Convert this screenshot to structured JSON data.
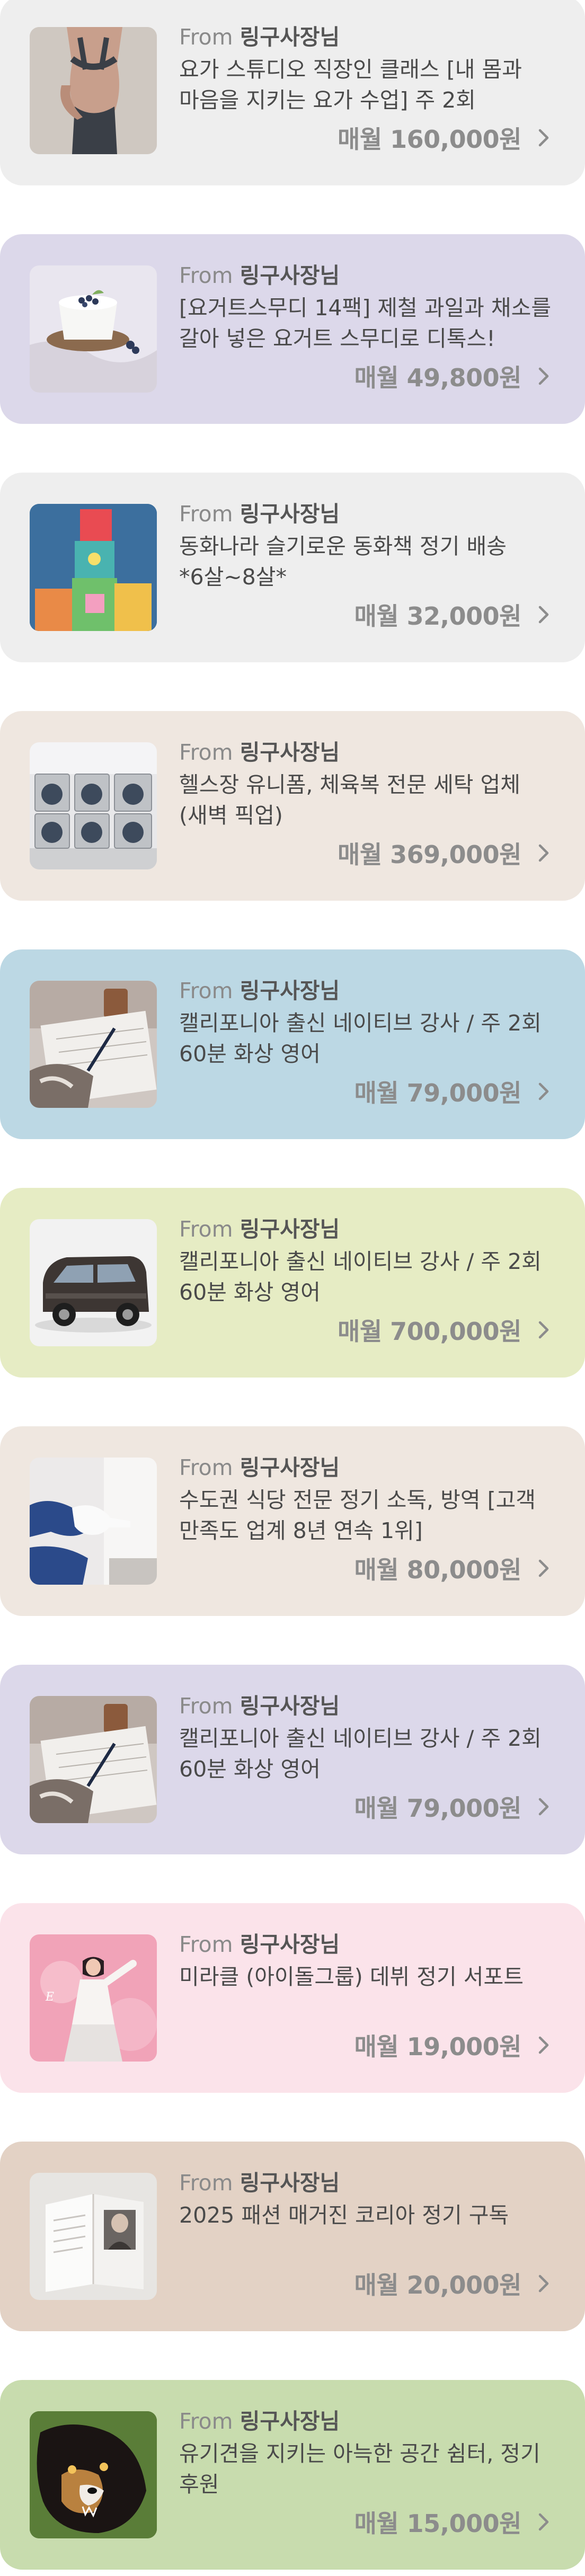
{
  "subscriptions": [
    {
      "from_label": "From",
      "sender": "링구사장님",
      "title": "요가 스튜디오 직장인 클래스 [내 몸과 마음을 지키는 요가 수업] 주 2회",
      "price": "매월 160,000원",
      "bg": "#eeeeee",
      "thumb": "yoga"
    },
    {
      "from_label": "From",
      "sender": "링구사장님",
      "title": "[요거트스무디 14팩] 제철 과일과 채소를 갈아 넣은 요거트 스무디로 디톡스!",
      "price": "매월 49,800원",
      "bg": "#dcd8ea",
      "thumb": "yogurt"
    },
    {
      "from_label": "From",
      "sender": "링구사장님",
      "title": "동화나라 슬기로운 동화책 정기 배송 *6살~8살*",
      "price": "매월 32,000원",
      "bg": "#eeeeee",
      "thumb": "blocks"
    },
    {
      "from_label": "From",
      "sender": "링구사장님",
      "title": "헬스장 유니폼, 체육복 전문 세탁 업체 (새벽 픽업)",
      "price": "매월 369,000원",
      "bg": "#efe7e0",
      "thumb": "laundry"
    },
    {
      "from_label": "From",
      "sender": "링구사장님",
      "title": "캘리포니아 출신 네이티브 강사 / 주 2회 60분 화상 영어",
      "price": "매월 79,000원",
      "bg": "#bcd8e4",
      "thumb": "writing"
    },
    {
      "from_label": "From",
      "sender": "링구사장님",
      "title": "캘리포니아 출신 네이티브 강사 / 주 2회 60분 화상 영어",
      "price": "매월 700,000원",
      "bg": "#e6ecc4",
      "thumb": "van"
    },
    {
      "from_label": "From",
      "sender": "링구사장님",
      "title": "수도권 식당 전문 정기 소독, 방역 [고객 만족도 업계 8년 연속 1위]",
      "price": "매월 80,000원",
      "bg": "#efe7e0",
      "thumb": "gloves"
    },
    {
      "from_label": "From",
      "sender": "링구사장님",
      "title": "캘리포니아 출신 네이티브 강사 / 주 2회 60분 화상 영어",
      "price": "매월 79,000원",
      "bg": "#dcd8ea",
      "thumb": "writing"
    },
    {
      "from_label": "From",
      "sender": "링구사장님",
      "title": "미라클 (아이돌그룹) 데뷔 정기 서포트",
      "price": "매월 19,000원",
      "bg": "#fbe3ea",
      "thumb": "idol"
    },
    {
      "from_label": "From",
      "sender": "링구사장님",
      "title": "2025 패션 매거진 코리아 정기 구독",
      "price": "매월 20,000원",
      "bg": "#e3d2c5",
      "thumb": "magazine"
    },
    {
      "from_label": "From",
      "sender": "링구사장님",
      "title": "유기견을 지키는 아늑한 공간 쉼터, 정기 후원",
      "price": "매월 15,000원",
      "bg": "#c8dcae",
      "thumb": "dog"
    }
  ]
}
